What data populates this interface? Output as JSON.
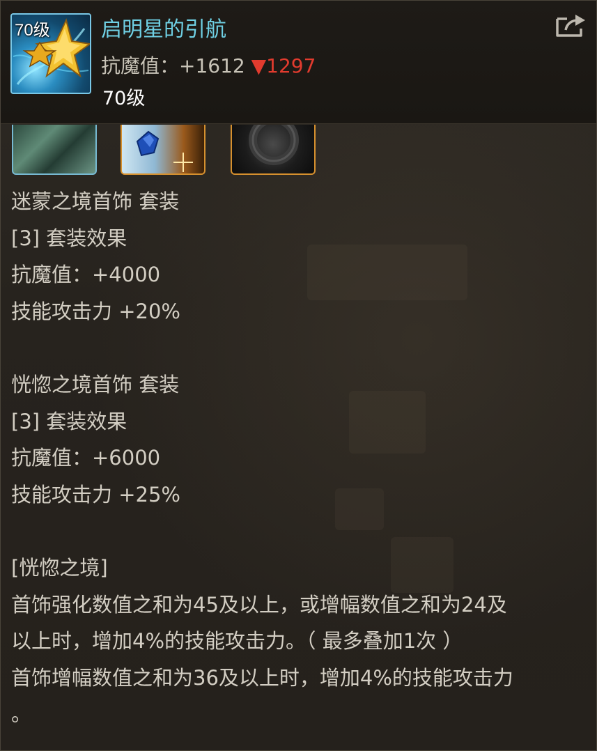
{
  "item": {
    "icon_level": "70级",
    "name": "启明星的引航",
    "stat_label": "抗魔值：",
    "stat_value": "+1612",
    "stat_diff": "▼1297",
    "level": "70级",
    "share_icon": "share-icon"
  },
  "colors": {
    "name": "#6fd0e4",
    "stat_down": "#e23b2e",
    "text": "#d3cec3",
    "slot_border_blue": "#77b9d2",
    "slot_border_orange": "#d6902e"
  },
  "sets": [
    {
      "title": "迷蒙之境首饰  套装",
      "effect_header": "[3] 套装效果",
      "lines": [
        "抗魔值：+4000",
        "技能攻击力 +20%"
      ]
    },
    {
      "title": "恍惚之境首饰  套装",
      "effect_header": "[3] 套装效果",
      "lines": [
        "抗魔值：+6000",
        "技能攻击力 +25%"
      ]
    }
  ],
  "special": {
    "title": "[恍惚之境]",
    "lines": [
      "首饰强化数值之和为45及以上，或增幅数值之和为24及",
      "以上时，增加4%的技能攻击力。（ 最多叠加1次 ）",
      "首饰增幅数值之和为36及以上时，增加4%的技能攻击力",
      "。"
    ]
  }
}
